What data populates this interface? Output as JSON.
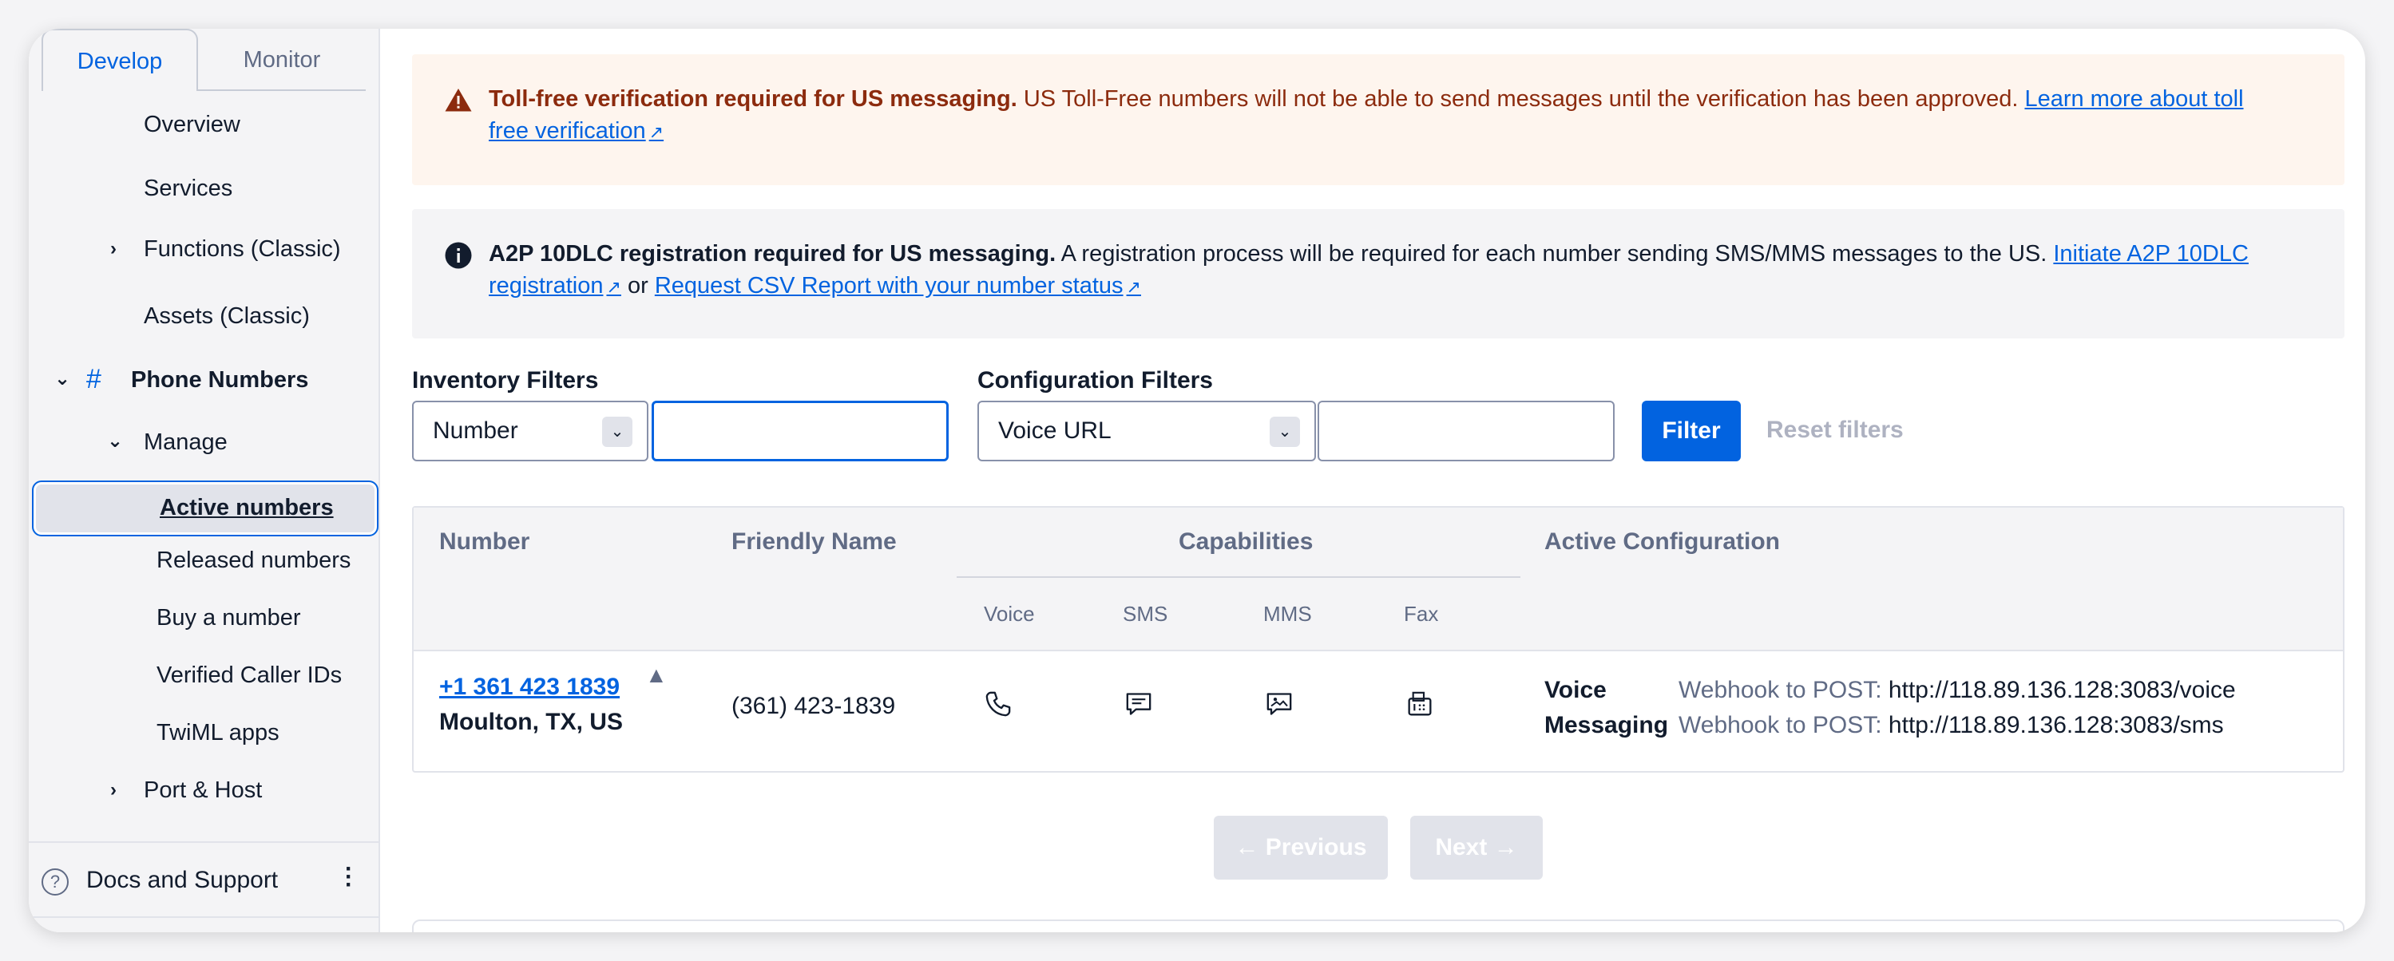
{
  "sidebar": {
    "tabs": [
      {
        "label": "Develop"
      },
      {
        "label": "Monitor"
      }
    ],
    "items": {
      "overview": "Overview",
      "services": "Services",
      "functions": "Functions (Classic)",
      "assets": "Assets (Classic)",
      "phone_numbers": "Phone Numbers",
      "manage": "Manage",
      "active_numbers": "Active numbers",
      "released_numbers": "Released numbers",
      "buy_number": "Buy a number",
      "verified_caller_ids": "Verified Caller IDs",
      "twiml_apps": "TwiML apps",
      "port_host": "Port & Host"
    },
    "docs": "Docs and Support",
    "hash_symbol": "#"
  },
  "alerts": {
    "warning": {
      "title": "Toll-free verification required for US messaging.",
      "body": "US Toll-Free numbers will not be able to send messages until the verification has been approved.",
      "link": "Learn more about toll free verification"
    },
    "info": {
      "title": "A2P 10DLC registration required for US messaging.",
      "body": "A registration process will be required for each number sending SMS/MMS messages to the US.",
      "link1": "Initiate A2P 10DLC registration",
      "or": "or",
      "link2": "Request CSV Report with your number status"
    }
  },
  "filters": {
    "inventory_label": "Inventory Filters",
    "inventory_select": "Number",
    "inventory_value": "",
    "config_label": "Configuration Filters",
    "config_select": "Voice URL",
    "config_value": "",
    "filter_button": "Filter",
    "reset_button": "Reset filters"
  },
  "table": {
    "headers": {
      "number": "Number",
      "friendly_name": "Friendly Name",
      "capabilities": "Capabilities",
      "active_configuration": "Active Configuration",
      "voice": "Voice",
      "sms": "SMS",
      "mms": "MMS",
      "fax": "Fax"
    },
    "rows": [
      {
        "number": "+1 361 423 1839",
        "location": "Moulton, TX, US",
        "friendly_name": "(361) 423-1839",
        "voice_label": "Voice",
        "voice_prefix": "Webhook to POST:",
        "voice_url": "http://118.89.136.128:3083/voice",
        "messaging_label": "Messaging",
        "messaging_prefix": "Webhook to POST:",
        "messaging_url": "http://118.89.136.128:3083/sms"
      }
    ]
  },
  "pagination": {
    "previous": "Previous",
    "next": "Next"
  },
  "colors": {
    "accent": "#0263e0",
    "warning_bg": "#fef5ee",
    "warning_text": "#8c2b0e",
    "info_bg": "#f4f4f6"
  },
  "icons": [
    "warning-icon",
    "info-icon",
    "external-link-icon",
    "chevron-right-icon",
    "chevron-down-icon",
    "help-icon",
    "kebab-icon",
    "phone-icon",
    "sms-icon",
    "mms-icon",
    "fax-icon",
    "sort-up-icon",
    "arrow-left-icon",
    "arrow-right-icon"
  ]
}
